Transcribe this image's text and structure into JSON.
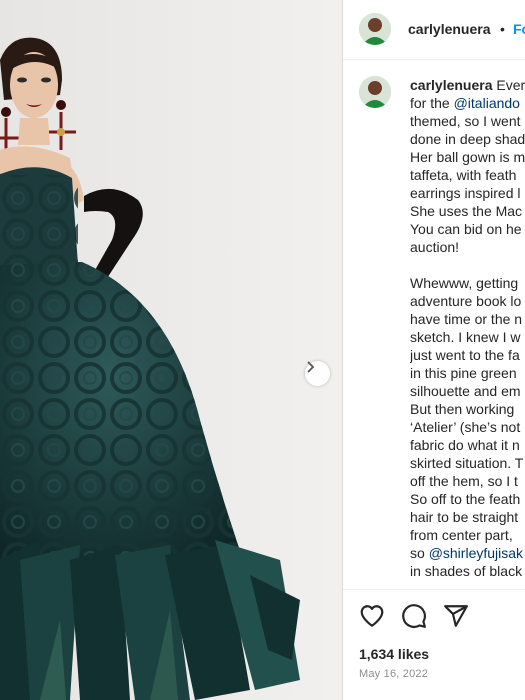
{
  "post": {
    "author": "carlylenuera",
    "follow_label": "Fo",
    "separator": "•",
    "caption_lines": [
      "Ever",
      "for the @italiando",
      "themed, so I went",
      "done in deep shad",
      "Her ball gown is m",
      "taffeta, with feath",
      "earrings inspired l",
      "She uses the Mac",
      "You can bid on he",
      "auction!",
      "",
      "Whewww, getting",
      "adventure book lo",
      "have time or the n",
      "sketch. I knew I w",
      "just went to the fa",
      "in this pine green",
      "silhouette and em",
      "But then working",
      "‘Atelier’ (she’s not",
      "fabric do what it n",
      "skirted situation. T",
      "off the hem, so I t",
      "So off to the feath",
      "hair to be straight",
      "from center part,",
      "so @shirleyfujisak",
      "in shades of black"
    ],
    "mention_1": "@italiando",
    "mention_2": "@shirleyfujisak",
    "likes": "1,634 likes",
    "date": "May 16, 2022"
  },
  "icons": [
    "chevron-right-icon",
    "heart-icon",
    "comment-icon",
    "share-icon",
    "avatar"
  ],
  "colors": {
    "accent": "#0095f6",
    "mention": "#00376b",
    "gown": "#1f3f40",
    "background": "#ecebea"
  }
}
